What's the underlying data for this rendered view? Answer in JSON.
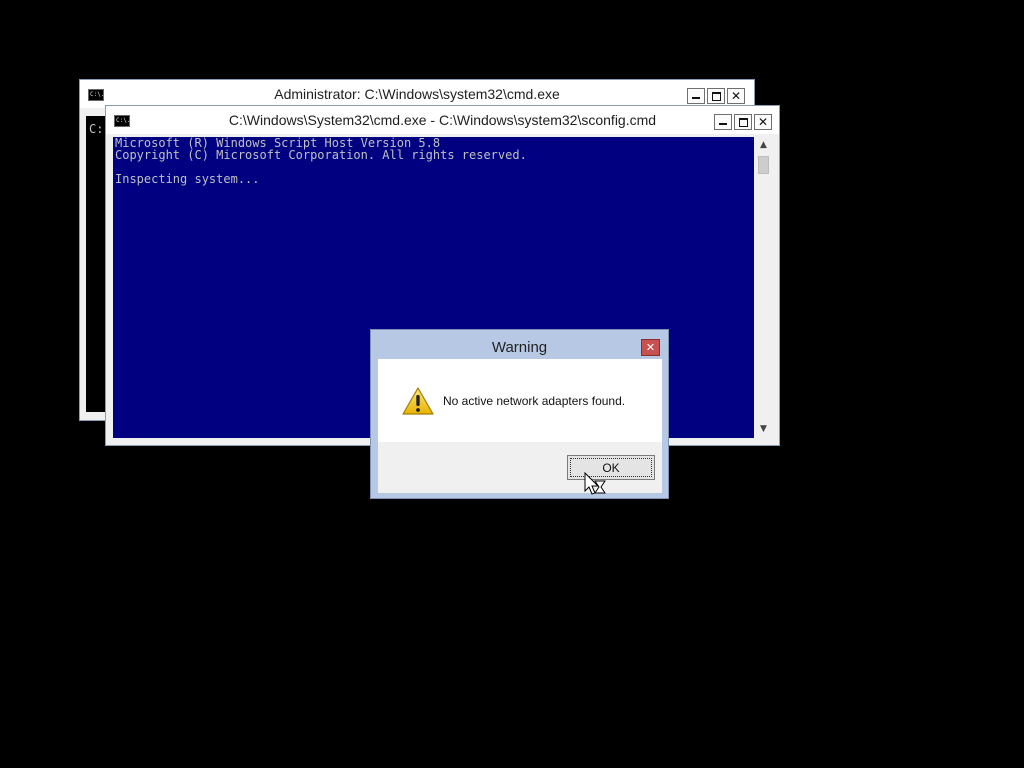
{
  "back_window": {
    "title": "Administrator: C:\\Windows\\system32\\cmd.exe",
    "icon_text": "C:\\.",
    "visible_text": "C:"
  },
  "front_window": {
    "title": "C:\\Windows\\System32\\cmd.exe - C:\\Windows\\system32\\sconfig.cmd",
    "icon_text": "C:\\.",
    "console_lines": [
      "Microsoft (R) Windows Script Host Version 5.8",
      "Copyright (C) Microsoft Corporation. All rights reserved.",
      "",
      "Inspecting system..."
    ]
  },
  "dialog": {
    "title": "Warning",
    "message": "No active network adapters found.",
    "ok_label": "OK",
    "icon": "warning-icon"
  },
  "controls": {
    "minimize_icon": "minimize-icon",
    "maximize_icon": "maximize-icon",
    "close_symbol": "✕"
  },
  "scrollbar": {
    "up_arrow": "▲",
    "down_arrow": "▼"
  },
  "colors": {
    "console_bg": "#000080",
    "console_fg": "#c0c0c0",
    "desktop_bg": "#000000",
    "close_button": "#c75050"
  }
}
